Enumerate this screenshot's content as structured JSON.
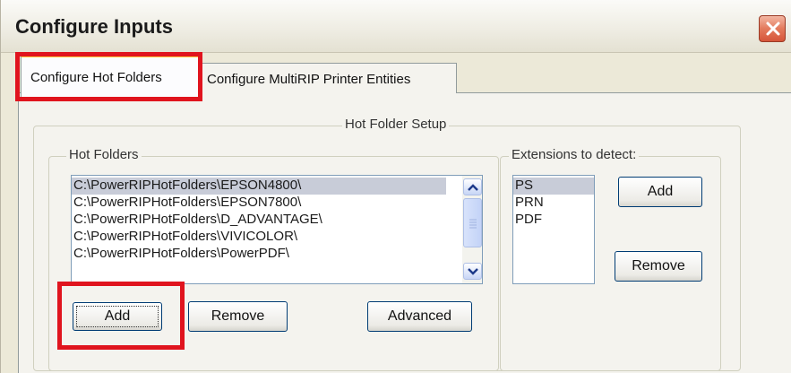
{
  "window": {
    "title": "Configure Inputs"
  },
  "tabs": [
    {
      "label": "Configure Hot Folders"
    },
    {
      "label": "Configure MultiRIP Printer Entities"
    }
  ],
  "hot_folder_setup": {
    "group_label": "Hot Folder Setup",
    "hot_folders": {
      "group_label": "Hot Folders",
      "items": [
        "C:\\PowerRIPHotFolders\\EPSON4800\\",
        "C:\\PowerRIPHotFolders\\EPSON7800\\",
        "C:\\PowerRIPHotFolders\\D_ADVANTAGE\\",
        "C:\\PowerRIPHotFolders\\VIVICOLOR\\",
        "C:\\PowerRIPHotFolders\\PowerPDF\\"
      ],
      "selected_index": 0,
      "add_label": "Add",
      "remove_label": "Remove",
      "advanced_label": "Advanced"
    },
    "extensions": {
      "group_label": "Extensions to detect:",
      "items": [
        "PS",
        "PRN",
        "PDF"
      ],
      "selected_index": 0,
      "add_label": "Add",
      "remove_label": "Remove"
    }
  },
  "icons": {
    "close": "close-icon",
    "scroll_up": "chevron-up-icon",
    "scroll_down": "chevron-down-icon"
  },
  "colors": {
    "highlight_box": "#e0141e",
    "dialog_face": "#ece9d8",
    "tab_face": "#f4f3ee",
    "close_button": "#d6553a",
    "button_border": "#003c74"
  }
}
